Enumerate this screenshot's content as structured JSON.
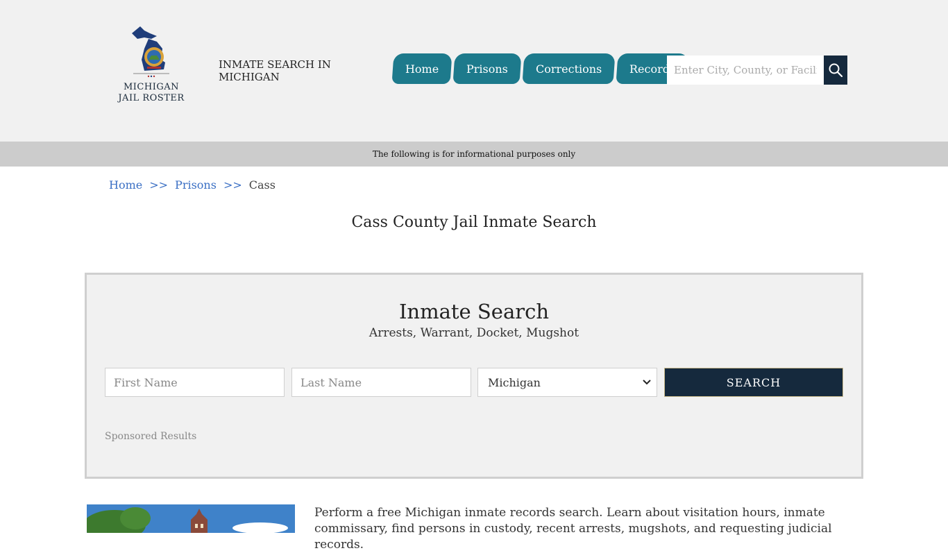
{
  "header": {
    "logo_text_line1": "MICHIGAN",
    "logo_text_line2": "JAIL ROSTER",
    "site_title": "INMATE SEARCH IN MICHIGAN",
    "nav": [
      {
        "label": "Home"
      },
      {
        "label": "Prisons"
      },
      {
        "label": "Corrections"
      },
      {
        "label": "Records"
      }
    ],
    "search_placeholder": "Enter City, County, or Facility"
  },
  "infobar": {
    "text": "The following is for informational purposes only"
  },
  "breadcrumb": {
    "items": [
      "Home",
      "Prisons"
    ],
    "separator": ">>",
    "current": "Cass"
  },
  "page_title": "Cass County Jail Inmate Search",
  "search_panel": {
    "title": "Inmate Search",
    "subtitle": "Arrests, Warrant, Docket, Mugshot",
    "first_name_placeholder": "First Name",
    "last_name_placeholder": "Last Name",
    "state_selected": "Michigan",
    "button_label": "SEARCH",
    "sponsored": "Sponsored Results"
  },
  "intro_text": "Perform a free Michigan inmate records search. Learn about visitation hours, inmate commissary, find persons in custody, recent arrests, mugshots, and requesting judicial records.",
  "colors": {
    "nav_bg": "#1d7a8c",
    "dark_navy": "#15293d",
    "link_blue": "#3a6fc4",
    "header_bg": "#f1f1f1",
    "infobar_bg": "#cccccc"
  }
}
